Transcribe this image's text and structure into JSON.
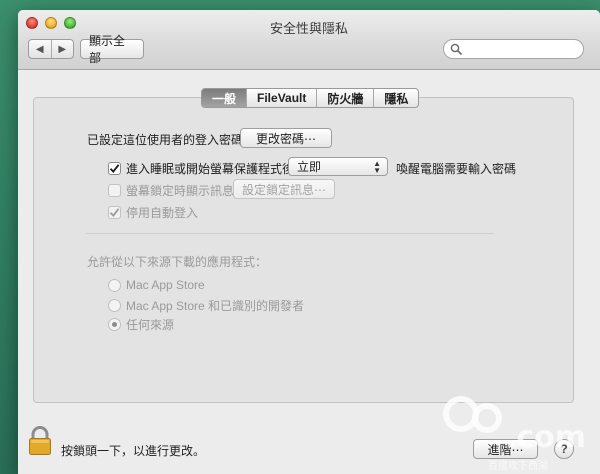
{
  "window": {
    "title": "安全性與隱私"
  },
  "toolbar": {
    "back_icon": "chevron-left-icon",
    "forward_icon": "chevron-right-icon",
    "show_all_label": "顯示全部",
    "search_placeholder": ""
  },
  "tabs": [
    {
      "label": "一般",
      "active": true
    },
    {
      "label": "FileVault",
      "active": false
    },
    {
      "label": "防火牆",
      "active": false
    },
    {
      "label": "隱私",
      "active": false
    }
  ],
  "general": {
    "password_set_label": "已設定這位使用者的登入密碼",
    "change_password_label": "更改密碼⋯",
    "require_password": {
      "checked": true,
      "prefix_label": "進入睡眠或開始螢幕保護程式後",
      "select_value": "立即",
      "suffix_label": "喚醒電腦需要輸入密碼"
    },
    "show_message": {
      "checked": false,
      "enabled": false,
      "label": "螢幕鎖定時顯示訊息",
      "button_label": "設定鎖定訊息⋯"
    },
    "disable_autologin": {
      "checked": true,
      "enabled": false,
      "label": "停用自動登入"
    },
    "downloads": {
      "heading": "允許從以下來源下載的應用程式：",
      "options": [
        {
          "label": "Mac App Store",
          "selected": false
        },
        {
          "label": "Mac App Store 和已識別的開發者",
          "selected": false
        },
        {
          "label": "任何來源",
          "selected": true
        }
      ]
    }
  },
  "footer": {
    "lock_text": "按鎖頭一下，以進行更改。",
    "advanced_label": "進階⋯",
    "help_label": "?"
  },
  "watermark": {
    "logo_text": ".com",
    "tagline": "百度攻下西湖"
  },
  "colors": {
    "tab_active": "#8e8e8e",
    "lock_gold": "#e0a92a",
    "desktop": "#2f7d61"
  }
}
